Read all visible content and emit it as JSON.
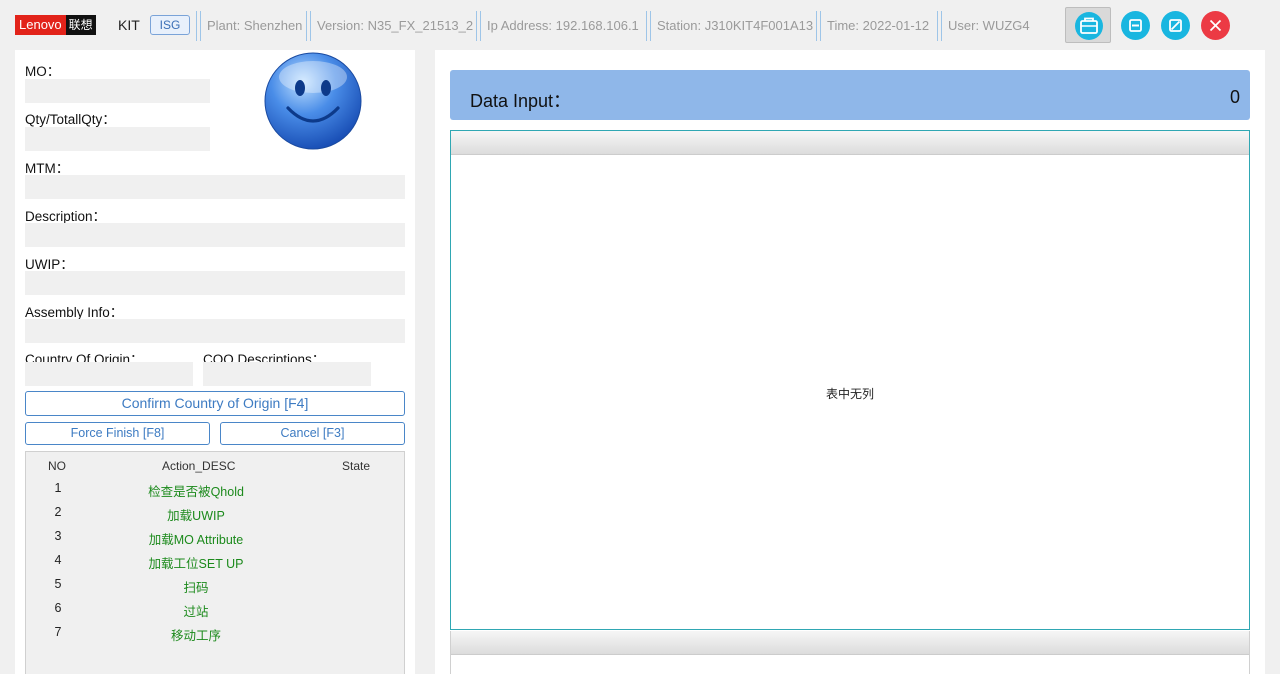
{
  "header": {
    "logo_en": "Lenovo",
    "logo_cn": "联想",
    "app_name": "KIT",
    "badge": "ISG",
    "plant": "Plant: Shenzhen",
    "version": "Version: N35_FX_21513_2",
    "ip": "Ip Address: 192.168.106.1",
    "station": "Station: J310KIT4F001A13",
    "time": "Time: 2022-01-12",
    "user": "User: WUZG4",
    "toolbox_icon": "toolbox-icon",
    "minimize_icon": "minimize-icon",
    "maximize_icon": "restore-icon",
    "close_icon": "close-icon"
  },
  "form": {
    "mo_label": "MO：",
    "qty_label": "Qty/TotallQty：",
    "mtm_label": "MTM：",
    "desc_label": "Description：",
    "uwip_label": "UWIP：",
    "assembly_label": "Assembly Info：",
    "coo_label": "Country Of Origin：",
    "coo_desc_label": "COO Descriptions：",
    "mo_value": "",
    "qty_value": "",
    "mtm_value": "",
    "desc_value": "",
    "uwip_value": "",
    "assembly_value": "",
    "coo_value": "",
    "coo_desc_value": "",
    "status_icon": "smiley-face-icon"
  },
  "buttons": {
    "confirm_coo": "Confirm Country of Origin [F4]",
    "force_finish": "Force Finish [F8]",
    "cancel": "Cancel [F3]"
  },
  "actions": {
    "columns": [
      "NO",
      "Action_DESC",
      "State"
    ],
    "rows": [
      {
        "no": "1",
        "desc": "检查是否被Qhold",
        "state": ""
      },
      {
        "no": "2",
        "desc": "加载UWIP",
        "state": ""
      },
      {
        "no": "3",
        "desc": "加载MO Attribute",
        "state": ""
      },
      {
        "no": "4",
        "desc": "加载工位SET UP",
        "state": ""
      },
      {
        "no": "5",
        "desc": "扫码",
        "state": ""
      },
      {
        "no": "6",
        "desc": "过站",
        "state": ""
      },
      {
        "no": "7",
        "desc": "移动工序",
        "state": ""
      }
    ],
    "desc_color": "#1c8a1c"
  },
  "data_input": {
    "label": "Data Input：",
    "count": "0",
    "bar_color": "#8fb7e9"
  },
  "grid": {
    "empty_text": "表中无列"
  }
}
